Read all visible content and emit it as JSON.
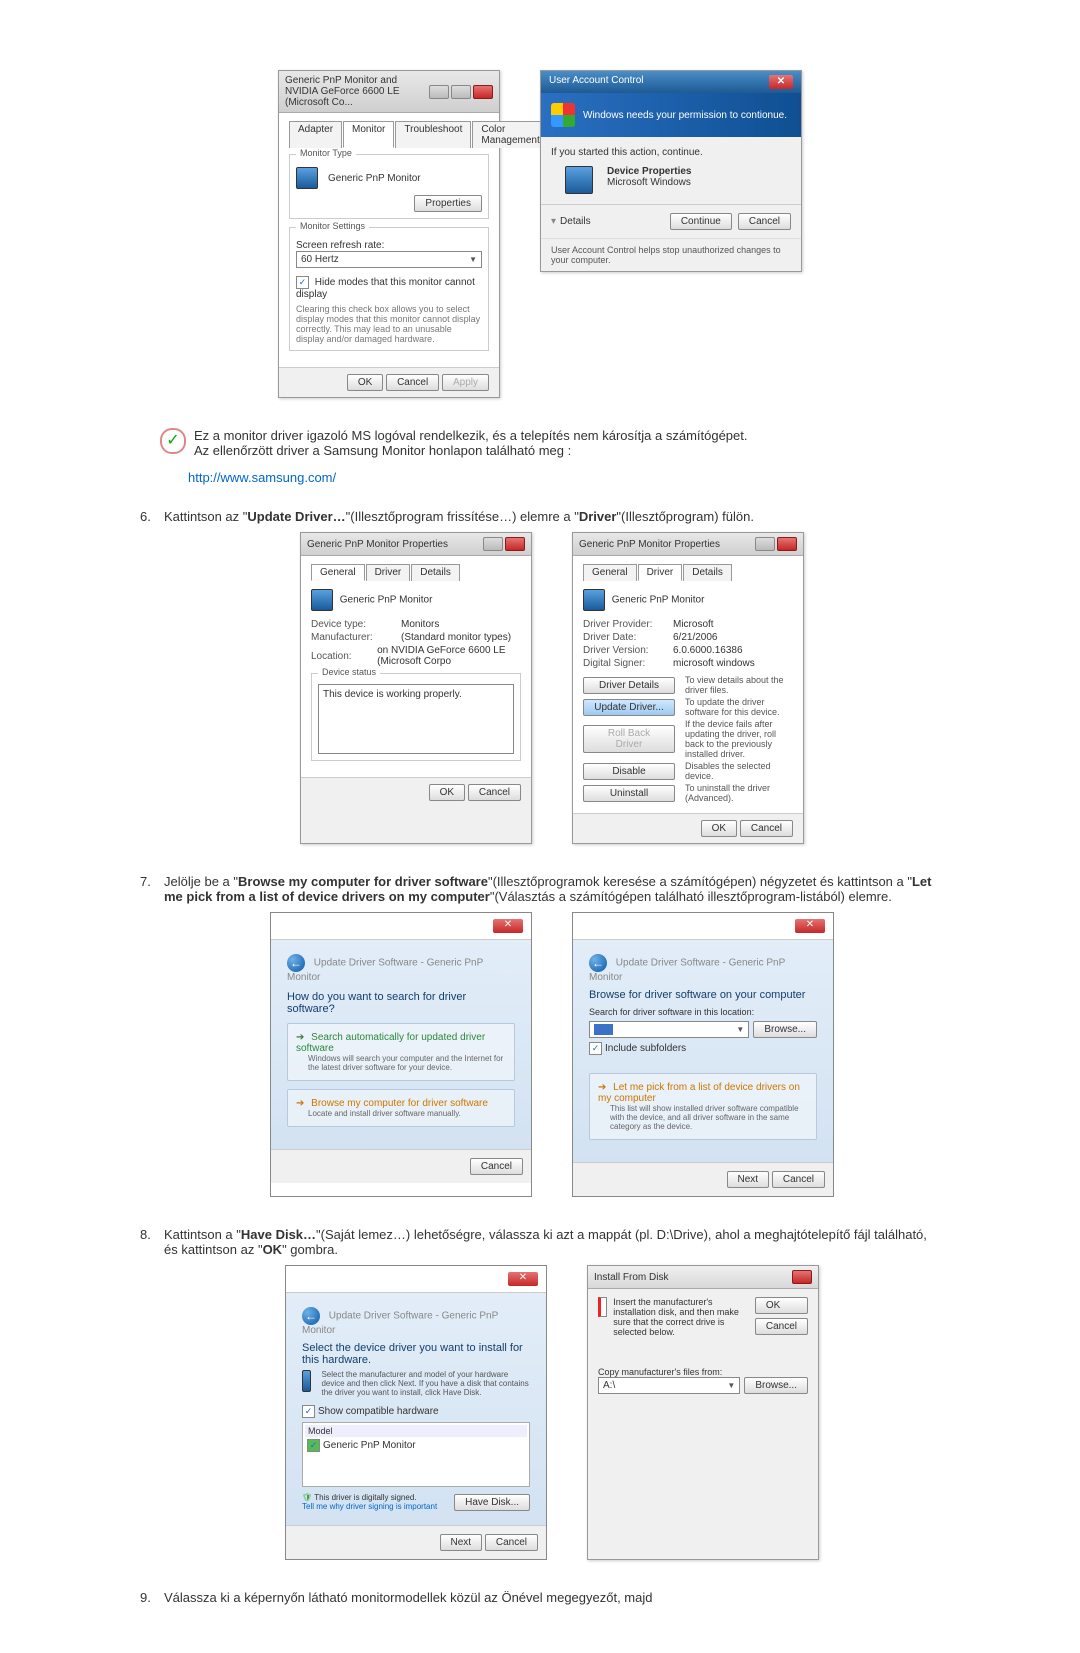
{
  "shot1": {
    "title": "Generic PnP Monitor and NVIDIA GeForce 6600 LE (Microsoft Co...",
    "tabs": [
      "Adapter",
      "Monitor",
      "Troubleshoot",
      "Color Management"
    ],
    "group_type": "Monitor Type",
    "monitor_name": "Generic PnP Monitor",
    "btn_props": "Properties",
    "group_settings": "Monitor Settings",
    "refresh_label": "Screen refresh rate:",
    "refresh_value": "60 Hertz",
    "hide_modes": "Hide modes that this monitor cannot display",
    "hide_desc": "Clearing this check box allows you to select display modes that this monitor cannot display correctly. This may lead to an unusable display and/or damaged hardware.",
    "ok": "OK",
    "cancel": "Cancel",
    "apply": "Apply"
  },
  "uac": {
    "title": "User Account Control",
    "headline": "Windows needs your permission to contionue.",
    "started": "If you started this action, continue.",
    "item1": "Device Properties",
    "item2": "Microsoft Windows",
    "details": "Details",
    "continue_btn": "Continue",
    "cancel": "Cancel",
    "footer": "User Account Control helps stop unauthorized changes to your computer."
  },
  "note": {
    "l1": "Ez a monitor driver igazoló MS logóval rendelkezik, és a telepítés nem károsítja a számítógépet.",
    "l2": "Az ellenőrzött driver a Samsung Monitor honlapon található meg :",
    "link": "http://www.samsung.com/"
  },
  "step6": {
    "n": "6.",
    "pre": "Kattintson az \"",
    "b1": "Update Driver…",
    "mid1": "\"(Illesztőprogram frissítése…) elemre a \"",
    "b2": "Driver",
    "post": "\"(Illesztőprogram) fülön."
  },
  "props1": {
    "title": "Generic PnP Monitor Properties",
    "tabs": [
      "General",
      "Driver",
      "Details"
    ],
    "name": "Generic PnP Monitor",
    "devtype_l": "Device type:",
    "devtype_v": "Monitors",
    "manu_l": "Manufacturer:",
    "manu_v": "(Standard monitor types)",
    "loc_l": "Location:",
    "loc_v": "on NVIDIA GeForce 6600 LE (Microsoft Corpo",
    "status_l": "Device status",
    "status_v": "This device is working properly.",
    "ok": "OK",
    "cancel": "Cancel"
  },
  "props2": {
    "title": "Generic PnP Monitor Properties",
    "tabs": [
      "General",
      "Driver",
      "Details"
    ],
    "name": "Generic PnP Monitor",
    "prov_l": "Driver Provider:",
    "prov_v": "Microsoft",
    "date_l": "Driver Date:",
    "date_v": "6/21/2006",
    "ver_l": "Driver Version:",
    "ver_v": "6.0.6000.16386",
    "sig_l": "Digital Signer:",
    "sig_v": "microsoft windows",
    "btn_details": "Driver Details",
    "btn_details_d": "To view details about the driver files.",
    "btn_update": "Update Driver...",
    "btn_update_d": "To update the driver software for this device.",
    "btn_roll": "Roll Back Driver",
    "btn_roll_d": "If the device fails after updating the driver, roll back to the previously installed driver.",
    "btn_disable": "Disable",
    "btn_disable_d": "Disables the selected device.",
    "btn_uninst": "Uninstall",
    "btn_uninst_d": "To uninstall the driver (Advanced).",
    "ok": "OK",
    "cancel": "Cancel"
  },
  "step7": {
    "n": "7.",
    "t1": "Jelölje be a \"",
    "b1": "Browse my computer for driver software",
    "t2": "\"(Illesztőprogramok keresése a számítógépen) négyzetet és kattintson a \"",
    "b2": "Let me pick from a list of device drivers on my computer",
    "t3": "\"(Választás a számítógépen található illesztőprogram-listából) elemre."
  },
  "wiz1": {
    "crumb": "Update Driver Software - Generic PnP Monitor",
    "q": "How do you want to search for driver software?",
    "o1t": "Search automatically for updated driver software",
    "o1d": "Windows will search your computer and the Internet for the latest driver software for your device.",
    "o2t": "Browse my computer for driver software",
    "o2d": "Locate and install driver software manually.",
    "cancel": "Cancel"
  },
  "wiz2": {
    "crumb": "Update Driver Software - Generic PnP Monitor",
    "h": "Browse for driver software on your computer",
    "lab": "Search for driver software in this location:",
    "browse": "Browse...",
    "chk": "Include subfolders",
    "o1t": "Let me pick from a list of device drivers on my computer",
    "o1d": "This list will show installed driver software compatible with the device, and all driver software in the same category as the device.",
    "next": "Next",
    "cancel": "Cancel"
  },
  "step8": {
    "n": "8.",
    "t1": "Kattintson a \"",
    "b1": "Have Disk…",
    "t2": "\"(Saját lemez…) lehetőségre, válassza ki azt a mappát (pl. D:\\Drive), ahol a meghajtótelepítő fájl található, és kattintson az \"",
    "b2": "OK",
    "t3": "\" gombra."
  },
  "wiz3": {
    "crumb": "Update Driver Software - Generic PnP Monitor",
    "h": "Select the device driver you want to install for this hardware.",
    "sub": "Select the manufacturer and model of your hardware device and then click Next. If you have a disk that contains the driver you want to install, click Have Disk.",
    "compat": "Show compatible hardware",
    "model": "Model",
    "item": "Generic PnP Monitor",
    "signed": "This driver is digitally signed.",
    "tell": "Tell me why driver signing is important",
    "have": "Have Disk...",
    "next": "Next",
    "cancel": "Cancel"
  },
  "disk": {
    "title": "Install From Disk",
    "msg": "Insert the manufacturer's installation disk, and then make sure that the correct drive is selected below.",
    "ok": "OK",
    "cancel": "Cancel",
    "lab": "Copy manufacturer's files from:",
    "val": "A:\\",
    "browse": "Browse..."
  },
  "step9": {
    "n": "9.",
    "text": "Válassza ki a képernyőn látható monitormodellek közül az Önével megegyezőt, majd"
  }
}
